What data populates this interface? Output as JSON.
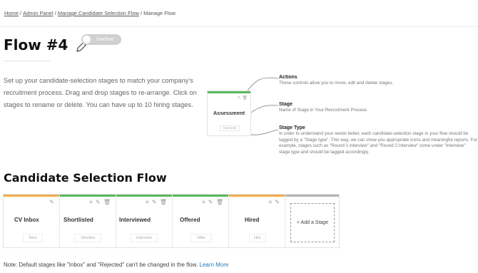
{
  "breadcrumb": {
    "home": "Home",
    "admin_panel": "Admin Panel",
    "manage_flow": "Manage Candidate Selection Flow",
    "current": "Manage Flow",
    "separator": "/"
  },
  "header": {
    "title": "Flow #4",
    "status_toggle": "Inactive"
  },
  "intro": "Set up your candidate-selection stages to match your company's recruitment process. Drag and drop stages to re-arrange. Click on stages to rename or delete. You can have up to 10 hiring stages.",
  "preview": {
    "stage_name": "Assessment",
    "stage_type": "Interview"
  },
  "annotations": [
    {
      "title": "Actions",
      "text": "These controls allow you to move, edit and delete stages."
    },
    {
      "title": "Stage",
      "text": "Name of Stage in Your Recruitment Process"
    },
    {
      "title": "Stage Type",
      "text": "In order to understand your needs better, each candidate-selection stage in your flow should be tagged by a \"Stage type\". This way, we can show you appropriate icons and meaningful reports. For example, stages such as \"Round 1 interview\" and \"Round 2 Interview\" come under \"Interview\" stage type and should be tagged accordingly."
    }
  ],
  "section_title": "Candidate Selection Flow",
  "stages": [
    {
      "name": "CV Inbox",
      "type": "New",
      "color": "#f0ad4e"
    },
    {
      "name": "Shortlisted",
      "type": "Shortlist",
      "color": "#5cb85c"
    },
    {
      "name": "Interviewed",
      "type": "Interview",
      "color": "#5cb85c"
    },
    {
      "name": "Offered",
      "type": "Offer",
      "color": "#5cb85c"
    },
    {
      "name": "Hired",
      "type": "Hire",
      "color": "#f0ad4e"
    }
  ],
  "add_stage_label": "+ Add a Stage",
  "note": {
    "text": "Note: Default stages like \"Inbox\" and \"Rejected\" can't be changed in the flow.",
    "link": "Learn More"
  }
}
